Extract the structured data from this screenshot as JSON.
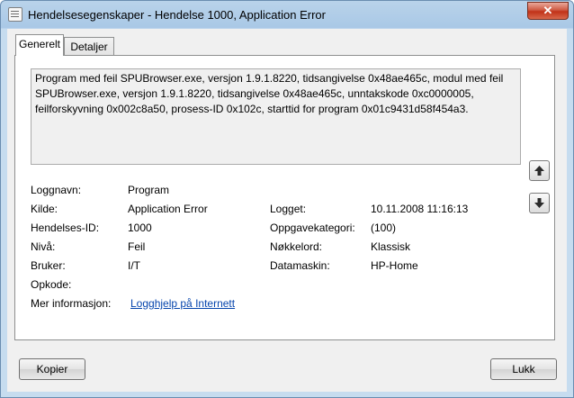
{
  "window": {
    "title": "Hendelsesegenskaper - Hendelse 1000, Application Error",
    "close_glyph": "✕"
  },
  "tabs": [
    {
      "label": "Generelt",
      "active": true
    },
    {
      "label": "Detaljer",
      "active": false
    }
  ],
  "description": "Program med feil SPUBrowser.exe, versjon 1.9.1.8220, tidsangivelse 0x48ae465c, modul med feil SPUBrowser.exe, versjon 1.9.1.8220, tidsangivelse 0x48ae465c, unntakskode 0xc0000005, feilforskyvning 0x002c8a50, prosess-ID 0x102c, starttid for program 0x01c9431d58f454a3.",
  "fields": {
    "loggnavn": {
      "label": "Loggnavn:",
      "value": "Program"
    },
    "kilde": {
      "label": "Kilde:",
      "value": "Application Error"
    },
    "hendelses_id": {
      "label": "Hendelses-ID:",
      "value": "1000"
    },
    "niva": {
      "label": "Nivå:",
      "value": "Feil"
    },
    "bruker": {
      "label": "Bruker:",
      "value": "I/T"
    },
    "opkode": {
      "label": "Opkode:",
      "value": ""
    },
    "mer_info": {
      "label": "Mer informasjon:",
      "value": "Logghjelp på Internett"
    },
    "logget": {
      "label": "Logget:",
      "value": "10.11.2008 11:16:13"
    },
    "oppgavekategori": {
      "label": "Oppgavekategori:",
      "value": "(100)"
    },
    "nokkelord": {
      "label": "Nøkkelord:",
      "value": "Klassisk"
    },
    "datamaskin": {
      "label": "Datamaskin:",
      "value": "HP-Home"
    }
  },
  "buttons": {
    "copy": "Kopier",
    "close": "Lukk"
  },
  "icons": {
    "scroll_up": "arrow-up-icon",
    "scroll_down": "arrow-down-icon"
  }
}
